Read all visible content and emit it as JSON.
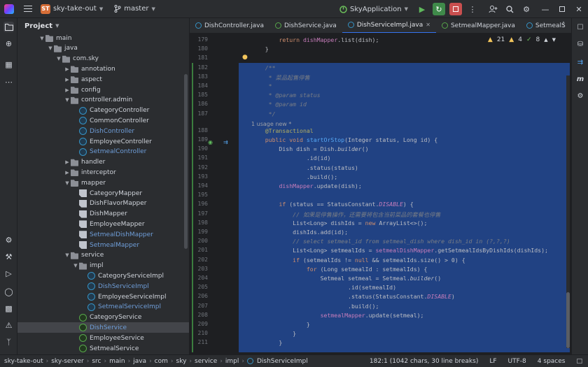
{
  "titlebar": {
    "project_badge": "ST",
    "project_name": "sky-take-out",
    "branch": "master",
    "run_config": "SkyApplication"
  },
  "project_panel": {
    "title": "Project",
    "rows": [
      {
        "label": "main",
        "depth": 3,
        "type": "folder",
        "open": true
      },
      {
        "label": "java",
        "depth": 4,
        "type": "folder",
        "open": true
      },
      {
        "label": "com.sky",
        "depth": 5,
        "type": "folder",
        "open": true
      },
      {
        "label": "annotation",
        "depth": 6,
        "type": "folder",
        "open": false
      },
      {
        "label": "aspect",
        "depth": 6,
        "type": "folder",
        "open": false
      },
      {
        "label": "config",
        "depth": 6,
        "type": "folder",
        "open": false
      },
      {
        "label": "controller.admin",
        "depth": 6,
        "type": "folder",
        "open": true
      },
      {
        "label": "CategoryController",
        "depth": 7,
        "type": "cls"
      },
      {
        "label": "CommonController",
        "depth": 7,
        "type": "cls"
      },
      {
        "label": "DishController",
        "depth": 7,
        "type": "cls",
        "modified": true
      },
      {
        "label": "EmployeeController",
        "depth": 7,
        "type": "cls"
      },
      {
        "label": "SetmealController",
        "depth": 7,
        "type": "cls",
        "modified": true
      },
      {
        "label": "handler",
        "depth": 6,
        "type": "folder",
        "open": false
      },
      {
        "label": "interceptor",
        "depth": 6,
        "type": "folder",
        "open": false
      },
      {
        "label": "mapper",
        "depth": 6,
        "type": "folder",
        "open": true
      },
      {
        "label": "CategoryMapper",
        "depth": 7,
        "type": "mapper"
      },
      {
        "label": "DishFlavorMapper",
        "depth": 7,
        "type": "mapper"
      },
      {
        "label": "DishMapper",
        "depth": 7,
        "type": "mapper"
      },
      {
        "label": "EmployeeMapper",
        "depth": 7,
        "type": "mapper"
      },
      {
        "label": "SetmealDishMapper",
        "depth": 7,
        "type": "mapper",
        "modified": true
      },
      {
        "label": "SetmealMapper",
        "depth": 7,
        "type": "mapper",
        "modified": true
      },
      {
        "label": "service",
        "depth": 6,
        "type": "folder",
        "open": true
      },
      {
        "label": "impl",
        "depth": 7,
        "type": "folder",
        "open": true
      },
      {
        "label": "CategoryServiceImpl",
        "depth": 8,
        "type": "cls"
      },
      {
        "label": "DishServiceImpl",
        "depth": 8,
        "type": "cls",
        "modified": true
      },
      {
        "label": "EmployeeServiceImpl",
        "depth": 8,
        "type": "cls"
      },
      {
        "label": "SetmealServiceImpl",
        "depth": 8,
        "type": "cls",
        "modified": true
      },
      {
        "label": "CategoryService",
        "depth": 7,
        "type": "iface"
      },
      {
        "label": "DishService",
        "depth": 7,
        "type": "iface",
        "modified": true,
        "selected": true
      },
      {
        "label": "EmployeeService",
        "depth": 7,
        "type": "iface"
      },
      {
        "label": "SetmealService",
        "depth": 7,
        "type": "iface"
      }
    ]
  },
  "tabs": [
    {
      "label": "DishController.java",
      "icon": "cls",
      "active": false
    },
    {
      "label": "DishService.java",
      "icon": "iface",
      "active": false
    },
    {
      "label": "DishServiceImpl.java",
      "icon": "cls",
      "active": true
    },
    {
      "label": "SetmealMapper.java",
      "icon": "iface",
      "active": false
    },
    {
      "label": "SetmealS",
      "icon": "cls",
      "active": false
    }
  ],
  "editor": {
    "indicators": {
      "warnings": "21",
      "weak": "4",
      "typos": "8"
    },
    "inlay_usage": "1 usage   new *",
    "gutter": [
      "179",
      "180",
      "181",
      "182",
      "183",
      "184",
      "185",
      "186",
      "187",
      "188",
      "189",
      "190",
      "191",
      "192",
      "193",
      "194",
      "195",
      "196",
      "197",
      "198",
      "199",
      "200",
      "201",
      "202",
      "203",
      "204",
      "205",
      "206",
      "207",
      "208",
      "209",
      "210",
      "211"
    ],
    "lines": [
      "        return dishMapper.list(dish);",
      "    }",
      "",
      "    /**",
      "     * 菜品起售停售",
      "     *",
      "     * @param status",
      "     * @param id",
      "     */",
      "    @Transactional",
      "    public void startOrStop(Integer status, Long id) {",
      "        Dish dish = Dish.builder()",
      "                .id(id)",
      "                .status(status)",
      "                .build();",
      "        dishMapper.update(dish);",
      "",
      "        if (status == StatusConstant.DISABLE) {",
      "            // 如果是停售操作，还需要将包含当前菜品的套餐也停售",
      "            List<Long> dishIds = new ArrayList<>();",
      "            dishIds.add(id);",
      "            // select setmeal_id from setmeal_dish where dish_id in (?,?,?)",
      "            List<Long> setmealIds = setmealDishMapper.getSetmealIdsByDishIds(dishIds);",
      "            if (setmealIds != null && setmealIds.size() > 0) {",
      "                for (Long setmealId : setmealIds) {",
      "                    Setmeal setmeal = Setmeal.builder()",
      "                            .id(setmealId)",
      "                            .status(StatusConstant.DISABLE)",
      "                            .build();",
      "                    setmealMapper.update(setmeal);",
      "                }",
      "            }",
      "        }"
    ]
  },
  "statusbar": {
    "breadcrumbs": [
      "sky-take-out",
      "sky-server",
      "src",
      "main",
      "java",
      "com",
      "sky",
      "service",
      "impl",
      "DishServiceImpl"
    ],
    "position": "182:1 (1042 chars, 30 line breaks)",
    "line_sep": "LF",
    "encoding": "UTF-8",
    "indent": "4 spaces"
  },
  "colors": {
    "accent": "#3574f0",
    "selection": "#214283",
    "keyword": "#cf8e6d",
    "method": "#56a8f5",
    "field": "#c77dbb"
  }
}
